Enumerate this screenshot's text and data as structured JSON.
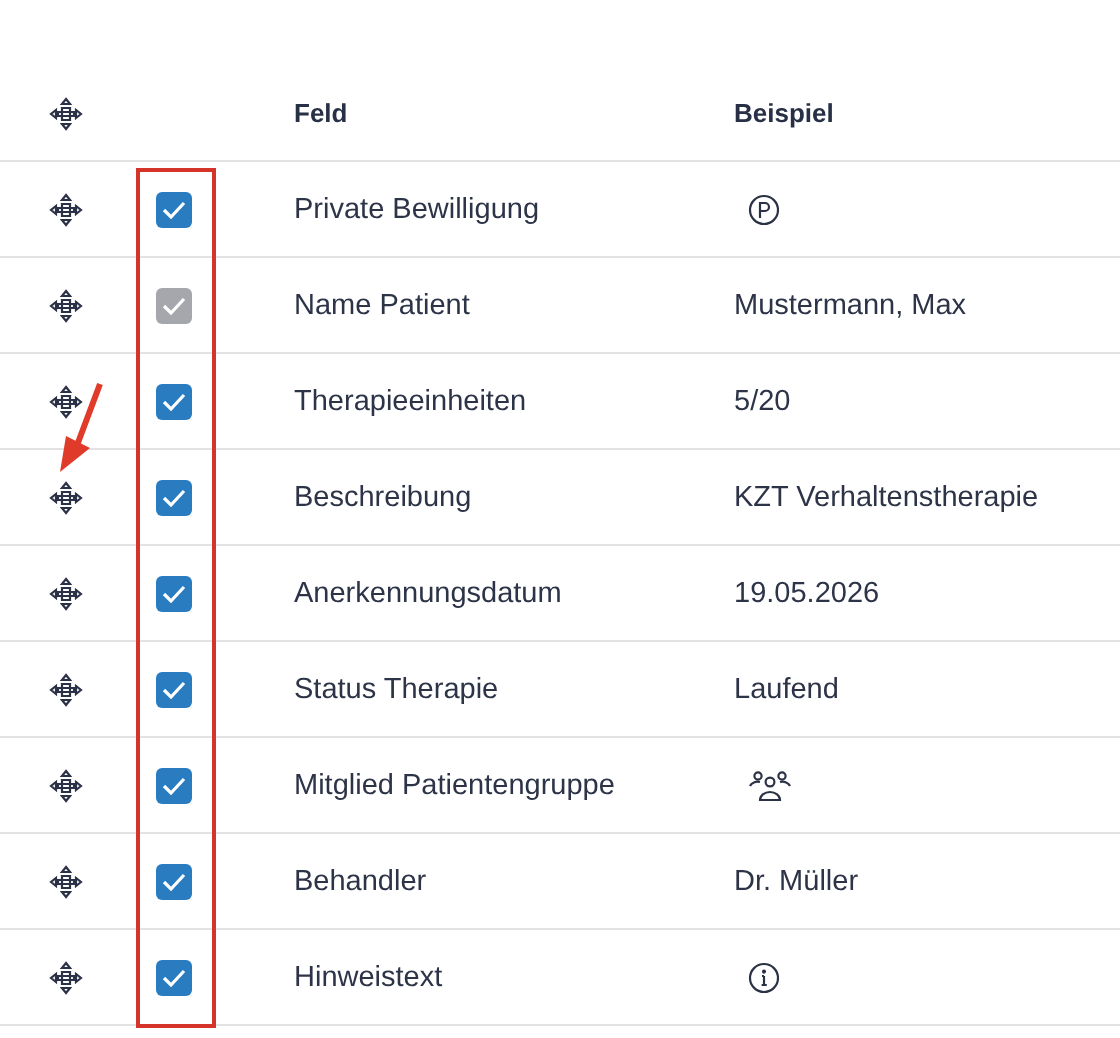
{
  "table": {
    "columns": [
      "Feld",
      "Beispiel"
    ],
    "rows": [
      {
        "field": "Private Bewilligung",
        "checked": true,
        "disabled": false,
        "example": {
          "kind": "parking"
        }
      },
      {
        "field": "Name Patient",
        "checked": true,
        "disabled": true,
        "example": {
          "kind": "text",
          "text": "Mustermann, Max"
        }
      },
      {
        "field": "Therapieeinheiten",
        "checked": true,
        "disabled": false,
        "example": {
          "kind": "text",
          "text": "5/20"
        }
      },
      {
        "field": "Beschreibung",
        "checked": true,
        "disabled": false,
        "example": {
          "kind": "text",
          "text": "KZT Verhaltenstherapie"
        }
      },
      {
        "field": "Anerkennungsdatum",
        "checked": true,
        "disabled": false,
        "example": {
          "kind": "text",
          "text": "19.05.2026"
        }
      },
      {
        "field": "Status Therapie",
        "checked": true,
        "disabled": false,
        "example": {
          "kind": "text",
          "text": "Laufend"
        }
      },
      {
        "field": "Mitglied Patientengruppe",
        "checked": true,
        "disabled": false,
        "example": {
          "kind": "group"
        }
      },
      {
        "field": "Behandler",
        "checked": true,
        "disabled": false,
        "example": {
          "kind": "text",
          "text": "Dr. Müller"
        }
      },
      {
        "field": "Hinweistext",
        "checked": true,
        "disabled": false,
        "example": {
          "kind": "info"
        }
      }
    ]
  }
}
